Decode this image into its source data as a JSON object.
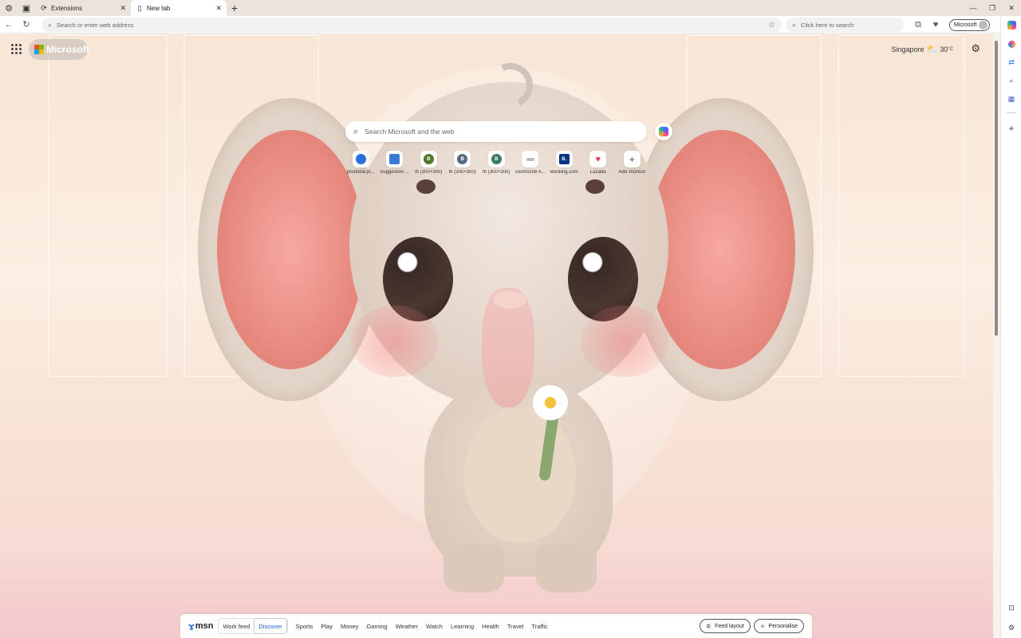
{
  "tabs": [
    {
      "title": "Extensions",
      "active": false
    },
    {
      "title": "New tab",
      "active": true
    }
  ],
  "toolbar": {
    "address_placeholder": "Search or enter web address",
    "bing_placeholder": "Click here to search",
    "profile_label": "Microsoft"
  },
  "page": {
    "brand": "Microsoft",
    "weather": {
      "city": "Singapore",
      "temp": "30",
      "unit": "°C"
    },
    "search_placeholder": "Search Microsoft and the web",
    "shortcuts": [
      {
        "label": "produkte.pl...",
        "letter": "",
        "color": "#2a6fdb"
      },
      {
        "label": "Suggestion ...",
        "letter": "",
        "color": "#3a7bd5"
      },
      {
        "label": "th (300×300)",
        "letter": "B",
        "color": "#4f7a2e"
      },
      {
        "label": "th (300×300)",
        "letter": "B",
        "color": "#5a6b84"
      },
      {
        "label": "th (300×300)",
        "letter": "B",
        "color": "#3b7a63"
      },
      {
        "label": "cosmos08 A...",
        "letter": "",
        "color": "#888888"
      },
      {
        "label": "Booking.com",
        "letter": "B.",
        "color": "#003580"
      },
      {
        "label": "Lazada",
        "letter": "",
        "color": "#f0365a"
      },
      {
        "label": "Add shortcut",
        "letter": "+",
        "color": "#ffffff"
      }
    ]
  },
  "feed": {
    "brand": "msn",
    "segments": [
      "Work feed",
      "Discover"
    ],
    "selected": "Discover",
    "nav": [
      "Sports",
      "Play",
      "Money",
      "Gaming",
      "Weather",
      "Watch",
      "Learning",
      "Health",
      "Travel",
      "Traffic"
    ],
    "buttons": [
      "Feed layout",
      "Personalise"
    ]
  },
  "colors": {
    "accent": "#1a63d6",
    "ms_red": "#f25022",
    "ms_green": "#7fba00",
    "ms_blue": "#00a4ef",
    "ms_yellow": "#ffb900"
  }
}
